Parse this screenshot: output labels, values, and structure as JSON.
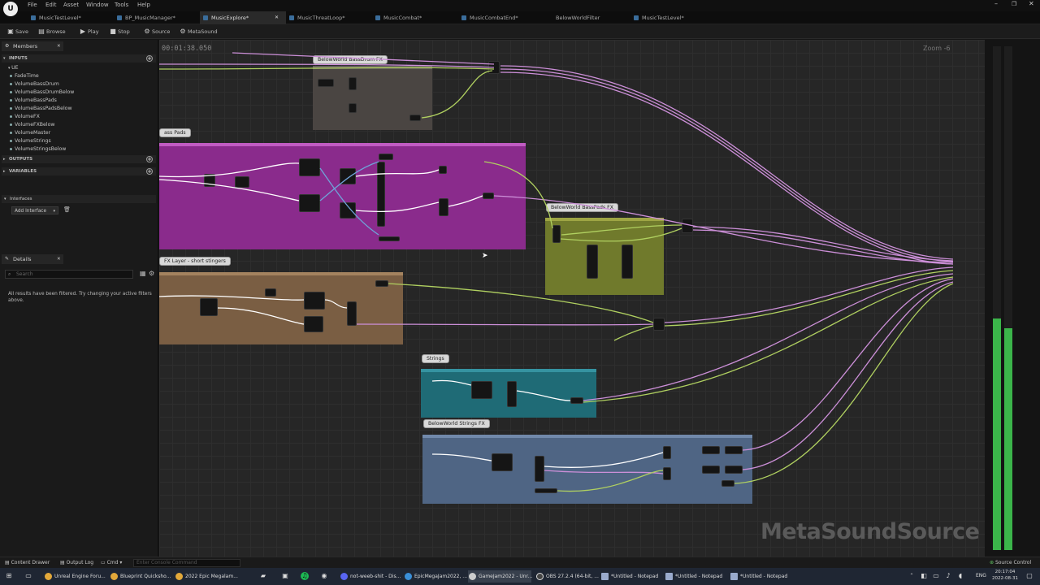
{
  "menu": [
    "File",
    "Edit",
    "Asset",
    "Window",
    "Tools",
    "Help"
  ],
  "tabs": [
    {
      "label": "MusicTestLevel*",
      "active": false
    },
    {
      "label": "BP_MusicManager*",
      "active": false
    },
    {
      "label": "MusicExplore*",
      "active": true
    },
    {
      "label": "MusicThreatLoop*",
      "active": false
    },
    {
      "label": "MusicCombat*",
      "active": false
    },
    {
      "label": "MusicCombatEnd*",
      "active": false
    },
    {
      "label": "BelowWorldFilter",
      "active": false
    },
    {
      "label": "MusicTestLevel*",
      "active": false
    }
  ],
  "toolbar": {
    "save": "Save",
    "browse": "Browse",
    "play": "Play",
    "stop": "Stop",
    "source": "Source",
    "metasound": "MetaSound"
  },
  "members_panel": {
    "title": "Members",
    "inputs_header": "INPUTS",
    "group": "UE",
    "inputs": [
      "FadeTime",
      "VolumeBassDrum",
      "VolumeBassDrumBelow",
      "VolumeBassPads",
      "VolumeBassPadsBelow",
      "VolumeFX",
      "VolumeFXBelow",
      "VolumeMaster",
      "VolumeStrings",
      "VolumeStringsBelow"
    ],
    "outputs_header": "OUTPUTS",
    "variables_header": "VARIABLES"
  },
  "interfaces_panel": {
    "title": "Interfaces",
    "add_button": "Add Interface"
  },
  "details_panel": {
    "title": "Details",
    "search_placeholder": "Search",
    "empty_message": "All results have been filtered. Try changing your active filters above."
  },
  "graph": {
    "timestamp": "00:01:38.050",
    "zoom": "Zoom -6",
    "watermark": "MetaSoundSource",
    "comments": [
      {
        "title": "BelowWorld BassDrum FX",
        "color": "#4a4542"
      },
      {
        "title": "ass Pads",
        "color": "#8a2b8c"
      },
      {
        "title": "BelowWorld BassPads FX",
        "color": "#707a2c"
      },
      {
        "title": "FX Layer - short stingers",
        "color": "#7a5e43"
      },
      {
        "title": "Strings",
        "color": "#1f6b76"
      },
      {
        "title": "BelowWorld Strings FX",
        "color": "#4f6584"
      }
    ]
  },
  "status": {
    "content_drawer": "Content Drawer",
    "output_log": "Output Log",
    "cmd": "Cmd",
    "console_placeholder": "Enter Console Command",
    "source_control": "Source Control"
  },
  "taskbar": {
    "items": [
      {
        "label": "Unreal Engine Foru...",
        "color": "#e2a83a"
      },
      {
        "label": "Blueprint Quicksho...",
        "color": "#e2a83a"
      },
      {
        "label": "2022 Epic Megalam...",
        "color": "#e2a83a"
      },
      {
        "label": "not-weeb-shit - Dis...",
        "color": "#5865f2"
      },
      {
        "label": "EpicMegaJam2022, ...",
        "color": "#3a8fd8"
      },
      {
        "label": "GameJam2022 - Unr...",
        "color": "#cccccc"
      },
      {
        "label": "OBS 27.2.4 (64-bit, ...",
        "color": "#444444"
      },
      {
        "label": "*Untitled - Notepad",
        "color": "#9ac"
      },
      {
        "label": "*Untitled - Notepad",
        "color": "#9ac"
      },
      {
        "label": "*Untitled - Notepad",
        "color": "#9ac"
      }
    ],
    "language": "ENG",
    "time": "20:17:04",
    "date": "2022-08-31"
  },
  "meter_levels": [
    0.46,
    0.44
  ]
}
